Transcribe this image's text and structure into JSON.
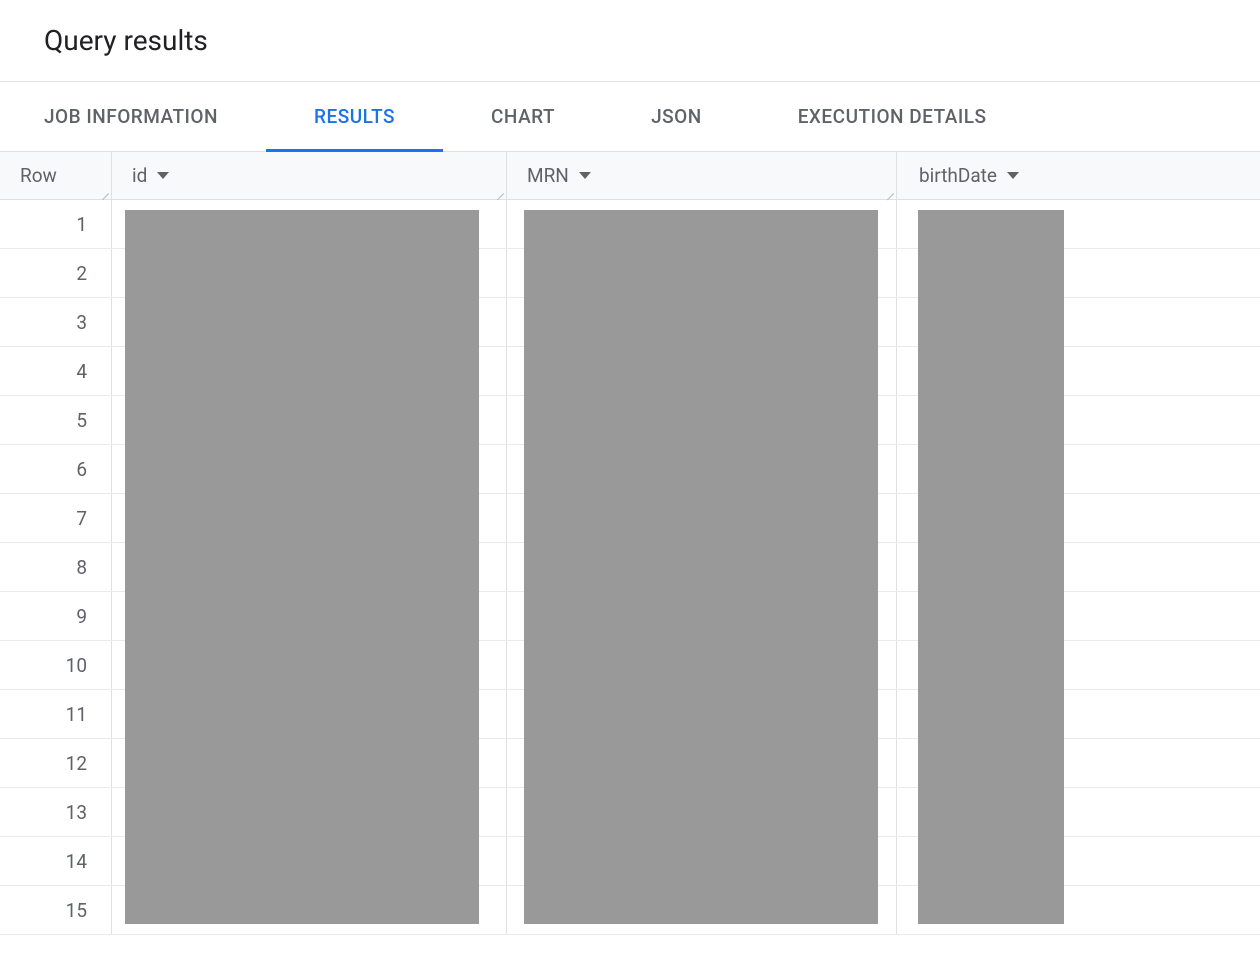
{
  "header": {
    "title": "Query results"
  },
  "tabs": [
    {
      "label": "JOB INFORMATION",
      "active": false
    },
    {
      "label": "RESULTS",
      "active": true
    },
    {
      "label": "CHART",
      "active": false
    },
    {
      "label": "JSON",
      "active": false
    },
    {
      "label": "EXECUTION DETAILS",
      "active": false
    }
  ],
  "table": {
    "columns": {
      "row": "Row",
      "id": "id",
      "mrn": "MRN",
      "birthdate": "birthDate"
    },
    "rows": [
      {
        "num": "1"
      },
      {
        "num": "2"
      },
      {
        "num": "3"
      },
      {
        "num": "4"
      },
      {
        "num": "5"
      },
      {
        "num": "6"
      },
      {
        "num": "7"
      },
      {
        "num": "8"
      },
      {
        "num": "9"
      },
      {
        "num": "10"
      },
      {
        "num": "11"
      },
      {
        "num": "12"
      },
      {
        "num": "13"
      },
      {
        "num": "14"
      },
      {
        "num": "15"
      }
    ]
  }
}
